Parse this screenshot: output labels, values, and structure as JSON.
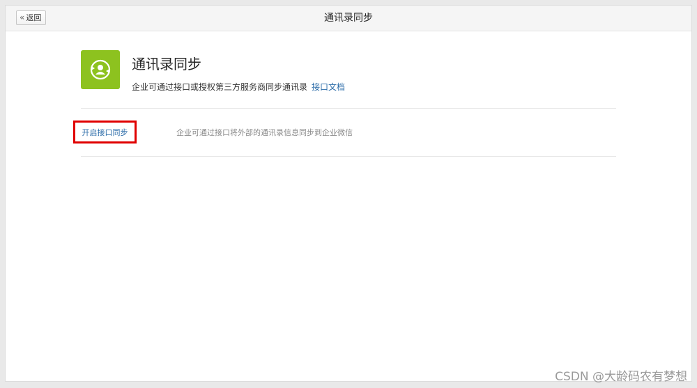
{
  "topbar": {
    "back_label": "返回",
    "title": "通讯录同步"
  },
  "header": {
    "icon": "contacts-sync-icon",
    "title": "通讯录同步",
    "description": "企业可通过接口或授权第三方服务商同步通讯录",
    "doc_link": "接口文档"
  },
  "sync_option": {
    "enable_label": "开启接口同步",
    "description": "企业可通过接口将外部的通讯录信息同步到企业微信"
  },
  "watermark": "CSDN @大龄码农有梦想",
  "colors": {
    "icon_bg": "#8dc21f",
    "link": "#2a6ba8",
    "highlight": "#e00000"
  }
}
